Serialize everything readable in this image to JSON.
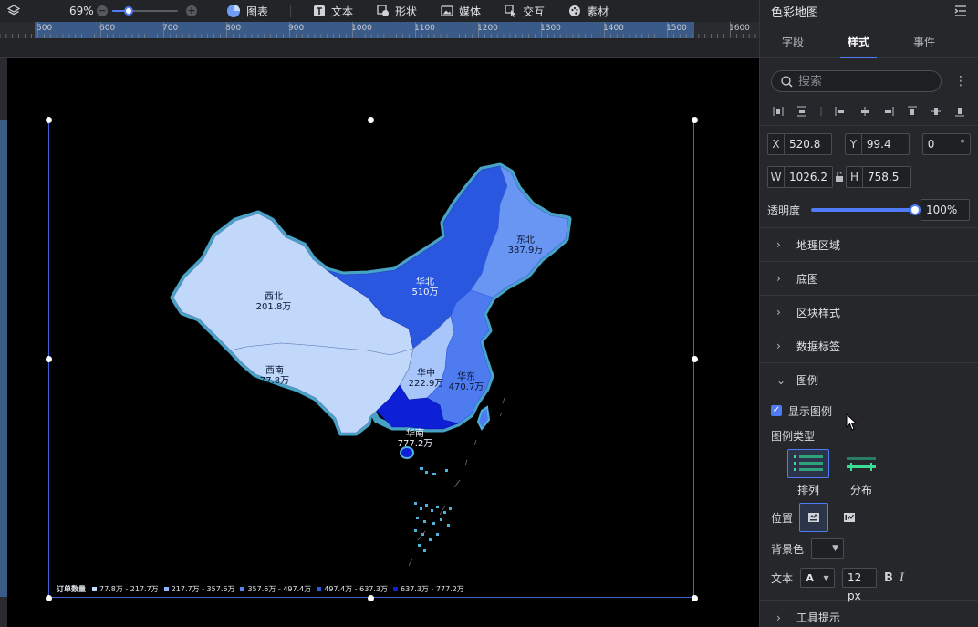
{
  "toolbar": {
    "zoom": "69%",
    "zoom_fraction": 0.25,
    "items": [
      "图表",
      "文本",
      "形状",
      "媒体",
      "交互",
      "素材"
    ],
    "icons": [
      "chart-icon",
      "text-icon",
      "shape-icon",
      "media-icon",
      "interact-icon",
      "material-icon"
    ]
  },
  "ruler": {
    "labels": [
      "500",
      "600",
      "700",
      "800",
      "900",
      "1000",
      "1100",
      "1200",
      "1300",
      "1400",
      "1500",
      "1600"
    ]
  },
  "map": {
    "regions": [
      {
        "name": "西北",
        "value": "201.8万",
        "color": "#c2d8fb"
      },
      {
        "name": "西南",
        "value": "77.8万",
        "color": "#c2d8fb"
      },
      {
        "name": "华北",
        "value": "510万",
        "color": "#2a57e0"
      },
      {
        "name": "东北",
        "value": "387.9万",
        "color": "#6a96f3"
      },
      {
        "name": "华中",
        "value": "222.9万",
        "color": "#a8c6fa"
      },
      {
        "name": "华东",
        "value": "470.7万",
        "color": "#4f7bf0"
      },
      {
        "name": "华南",
        "value": "777.2万",
        "color": "#0d20d6"
      }
    ],
    "border_color": "#4fb4dc"
  },
  "legend": {
    "title": "订单数量",
    "items": [
      {
        "label": "77.8万 - 217.7万",
        "color": "#c2d8fb"
      },
      {
        "label": "217.7万 - 357.6万",
        "color": "#8fb3f7"
      },
      {
        "label": "357.6万 - 497.4万",
        "color": "#5a86f0"
      },
      {
        "label": "497.4万 - 637.3万",
        "color": "#2f5ae6"
      },
      {
        "label": "637.3万 - 777.2万",
        "color": "#0d20d6"
      }
    ]
  },
  "panel": {
    "title": "色彩地图",
    "tabs": [
      "字段",
      "样式",
      "事件"
    ],
    "active_tab": "样式",
    "search_placeholder": "搜索",
    "x_label": "X",
    "x": "520.8",
    "y_label": "Y",
    "y": "99.4",
    "rotate": "0",
    "rotate_unit": "°",
    "w_label": "W",
    "w": "1026.2",
    "h_label": "H",
    "h": "758.5",
    "opacity_label": "透明度",
    "opacity": "100%",
    "sections": [
      "地理区域",
      "底图",
      "区块样式",
      "数据标签"
    ],
    "legend_section": "图例",
    "show_legend": "显示图例",
    "legend_type_label": "图例类型",
    "legend_types": [
      "排列",
      "分布"
    ],
    "position_label": "位置",
    "bg_label": "背景色",
    "text_label": "文本",
    "font_glyph": "A",
    "font_size": "12 px",
    "bold": "B",
    "italic": "I",
    "next_section": "工具提示"
  },
  "colors": {
    "accent": "#4f7bf7",
    "selection": "#3d63d8"
  }
}
